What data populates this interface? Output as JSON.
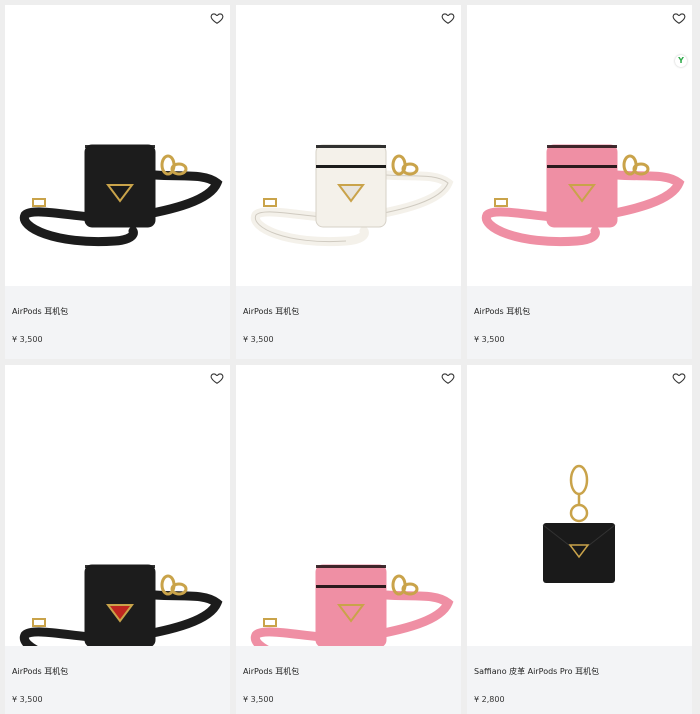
{
  "products": [
    {
      "name": "AirPods 耳机包",
      "price": "¥ 3,500",
      "color": "#1c1c1c",
      "trim": "#1c1c1c",
      "logo": "#1a1a1a",
      "style": "strap"
    },
    {
      "name": "AirPods 耳机包",
      "price": "¥ 3,500",
      "color": "#f4f1ea",
      "trim": "#1c1c1c",
      "logo": "#e8e4dc",
      "style": "strap"
    },
    {
      "name": "AirPods 耳机包",
      "price": "¥ 3,500",
      "color": "#ef8fa4",
      "trim": "#2b1a1d",
      "logo": "#ef8fa4",
      "style": "strap"
    },
    {
      "name": "AirPods 耳机包",
      "price": "¥ 3,500",
      "color": "#1c1c1c",
      "trim": "#1c1c1c",
      "logo": "#c0261f",
      "style": "strap"
    },
    {
      "name": "AirPods 耳机包",
      "price": "¥ 3,500",
      "color": "#ef8fa4",
      "trim": "#2b1a1d",
      "logo": "#ef8fa4",
      "style": "strap"
    },
    {
      "name": "Saffiano 皮革 AirPods Pro 耳机包",
      "price": "¥ 2,800",
      "color": "#1a1a1a",
      "trim": "#1a1a1a",
      "logo": "#1a1a1a",
      "style": "pouch"
    }
  ],
  "icons": {
    "wishlist": "heart-outline-icon",
    "badge": "y-badge-icon"
  },
  "badge_text": "Y",
  "colors": {
    "gold": "#c9a34a",
    "background": "#eeeeee",
    "card_footer": "#f3f4f6"
  }
}
